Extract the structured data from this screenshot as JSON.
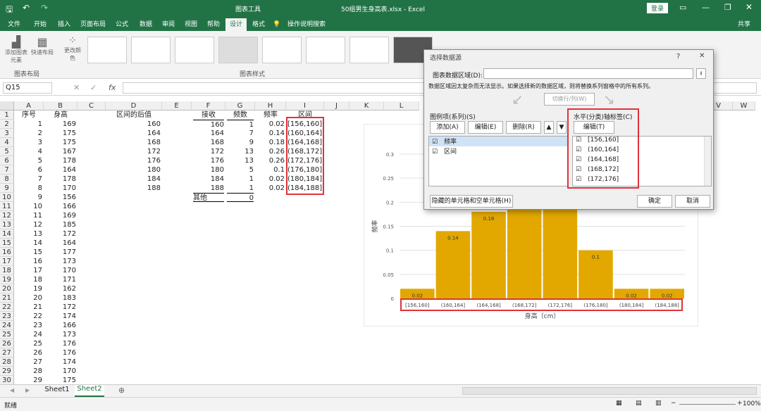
{
  "titlebar": {
    "tool_context": "图表工具",
    "filename": "50组男生身高表.xlsx - Excel",
    "login": "登录"
  },
  "tabs": [
    "文件",
    "开始",
    "插入",
    "页面布局",
    "公式",
    "数据",
    "审阅",
    "视图",
    "帮助",
    "设计",
    "格式"
  ],
  "active_tab": "设计",
  "search_hint": "操作说明搜索",
  "share": "共享",
  "ribbon": {
    "add_element": "添加图表元素",
    "quick_layout": "快速布局",
    "change_color": "更改颜色",
    "group_layout": "图表布局",
    "group_styles": "图表样式"
  },
  "formula": {
    "namebox": "Q15",
    "fx": "fx",
    "value": ""
  },
  "columns": [
    "A",
    "B",
    "C",
    "D",
    "E",
    "F",
    "G",
    "H",
    "I",
    "J",
    "K",
    "L",
    "V",
    "W"
  ],
  "rows": [
    "1",
    "2",
    "3",
    "4",
    "5",
    "6",
    "7",
    "8",
    "9",
    "10",
    "11",
    "12",
    "13",
    "14",
    "15",
    "16",
    "17",
    "18",
    "19",
    "20",
    "21",
    "22",
    "23",
    "24",
    "25",
    "26",
    "27",
    "28",
    "29",
    "30"
  ],
  "sheet": {
    "A": [
      "序号",
      "1",
      "2",
      "3",
      "4",
      "5",
      "6",
      "7",
      "8",
      "9",
      "10",
      "11",
      "12",
      "13",
      "14",
      "15",
      "16",
      "17",
      "18",
      "19",
      "20",
      "21",
      "22",
      "23",
      "24",
      "25",
      "26",
      "27",
      "28",
      "29"
    ],
    "B": [
      "身高",
      "169",
      "175",
      "175",
      "167",
      "178",
      "164",
      "178",
      "170",
      "156",
      "166",
      "169",
      "185",
      "172",
      "164",
      "177",
      "173",
      "170",
      "171",
      "162",
      "183",
      "172",
      "174",
      "166",
      "173",
      "176",
      "176",
      "174",
      "170",
      "175"
    ],
    "D": [
      "区间的后值",
      "160",
      "164",
      "168",
      "172",
      "176",
      "180",
      "184",
      "188"
    ],
    "F": [
      "接收",
      "160",
      "164",
      "168",
      "172",
      "176",
      "180",
      "184",
      "188",
      "其他"
    ],
    "G": [
      "频数",
      "1",
      "7",
      "9",
      "13",
      "13",
      "5",
      "1",
      "1",
      "0"
    ],
    "H": [
      "频率",
      "0.02",
      "0.14",
      "0.18",
      "0.26",
      "0.26",
      "0.1",
      "0.02",
      "0.02"
    ],
    "I": [
      "区间",
      "[156,160]",
      "(160,164]",
      "(164,168]",
      "(168,172]",
      "(172,176]",
      "(176,180]",
      "(180,184]",
      "(184,188]"
    ]
  },
  "dialog": {
    "title": "选择数据源",
    "help": "?",
    "close": "✕",
    "range_label": "图表数据区域(D):",
    "range_value": "",
    "warning": "数据区域因太复杂而无法显示。如果选择新的数据区域，则将替换系列窗格中的所有系列。",
    "switch": "切换行/列(W)",
    "legend_label": "图例项(系列)(S)",
    "add": "添加(A)",
    "edit": "编辑(E)",
    "delete": "删除(R)",
    "series": [
      "频率",
      "区间"
    ],
    "axis_label": "水平(分类)轴标签(C)",
    "axis_edit": "编辑(T)",
    "axis_items": [
      "[156,160]",
      "(160,164]",
      "(164,168]",
      "(168,172]",
      "(172,176]"
    ],
    "hidden_btn": "隐藏的单元格和空单元格(H)",
    "ok": "确定",
    "cancel": "取消"
  },
  "chart_data": {
    "type": "bar",
    "categories": [
      "[156,160]",
      "(160,164]",
      "(164,168]",
      "(168,172]",
      "(172,176]",
      "(176,180]",
      "(180,184]",
      "(184,188]"
    ],
    "values": [
      0.02,
      0.14,
      0.18,
      0.26,
      0.26,
      0.1,
      0.02,
      0.02
    ],
    "ylabel": "频率",
    "xlabel": "身高（cm）",
    "yticks": [
      "0",
      "0.05",
      "0.1",
      "0.15",
      "0.2",
      "0.25",
      "0.3"
    ],
    "ylim": [
      0,
      0.3
    ],
    "bar_color": "#E2A800"
  },
  "sheet_tabs": [
    "Sheet1",
    "Sheet2"
  ],
  "active_sheet": "Sheet2",
  "status": {
    "ready": "就绪",
    "zoom": "100%"
  }
}
